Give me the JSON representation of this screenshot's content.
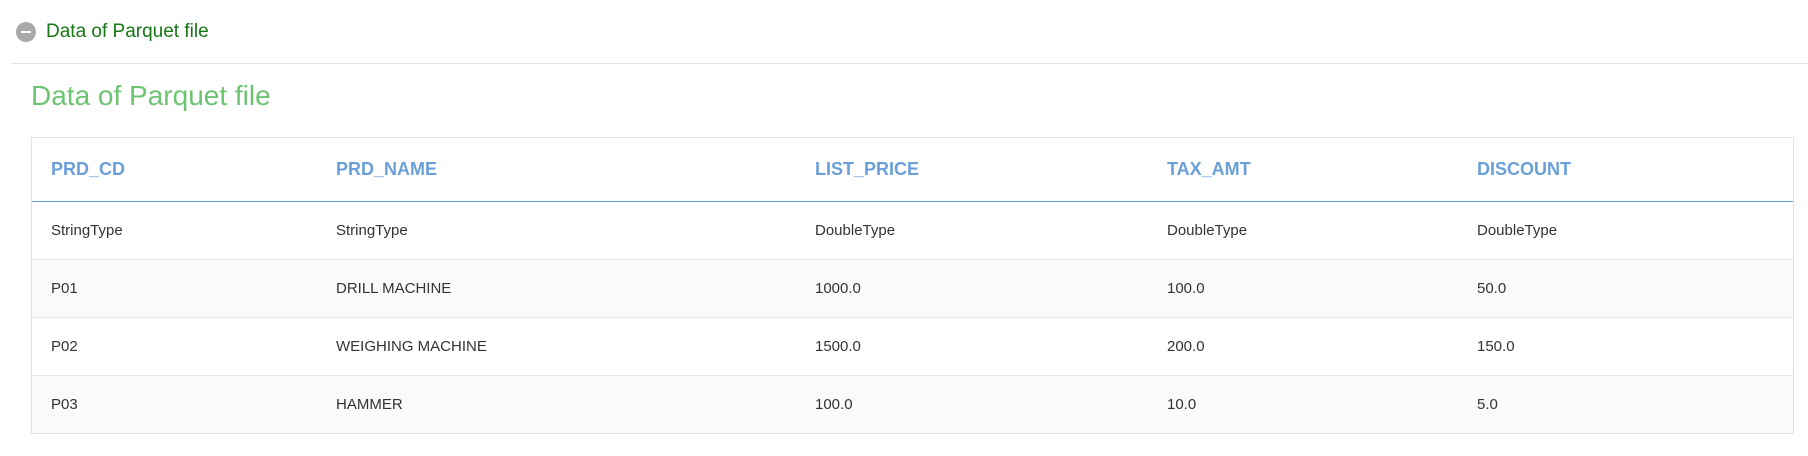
{
  "toggle": {
    "label": "Data of Parquet file"
  },
  "section": {
    "title": "Data of Parquet file"
  },
  "table": {
    "columns": [
      "PRD_CD",
      "PRD_NAME",
      "LIST_PRICE",
      "TAX_AMT",
      "DISCOUNT"
    ],
    "rows": [
      [
        "StringType",
        "StringType",
        "DoubleType",
        "DoubleType",
        "DoubleType"
      ],
      [
        "P01",
        "DRILL MACHINE",
        "1000.0",
        "100.0",
        "50.0"
      ],
      [
        "P02",
        "WEIGHING MACHINE",
        "1500.0",
        "200.0",
        "150.0"
      ],
      [
        "P03",
        "HAMMER",
        "100.0",
        "10.0",
        "5.0"
      ]
    ]
  },
  "colors": {
    "toggle_label": "#147814",
    "section_title": "#6cc472",
    "header_text": "#6a9fd8"
  },
  "icons": {
    "toggle": "minus-circle-icon"
  }
}
